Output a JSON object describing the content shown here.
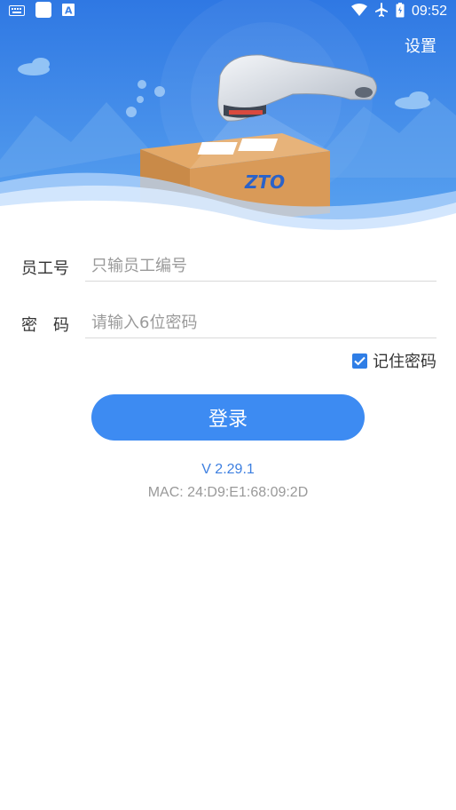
{
  "status_bar": {
    "time": "09:52",
    "left_icons": [
      "keyboard-icon",
      "app-square-icon",
      "translate-a-icon"
    ],
    "right_icons": [
      "wifi-icon",
      "airplane-icon",
      "battery-icon"
    ]
  },
  "header": {
    "settings_label": "设置",
    "brand_on_box": "ZTO"
  },
  "form": {
    "employee": {
      "label": "员工号",
      "placeholder": "只输员工编号",
      "value": ""
    },
    "password": {
      "label": "密　码",
      "placeholder": "请输入6位密码",
      "value": ""
    },
    "remember": {
      "label": "记住密码",
      "checked": true
    },
    "login_label": "登录"
  },
  "footer": {
    "version": "V 2.29.1",
    "mac": "MAC: 24:D9:E1:68:09:2D"
  },
  "colors": {
    "primary": "#3d8bf2",
    "hero_bg": "#4a8fe8",
    "version_text": "#3d7fe0",
    "muted_text": "#999999"
  }
}
